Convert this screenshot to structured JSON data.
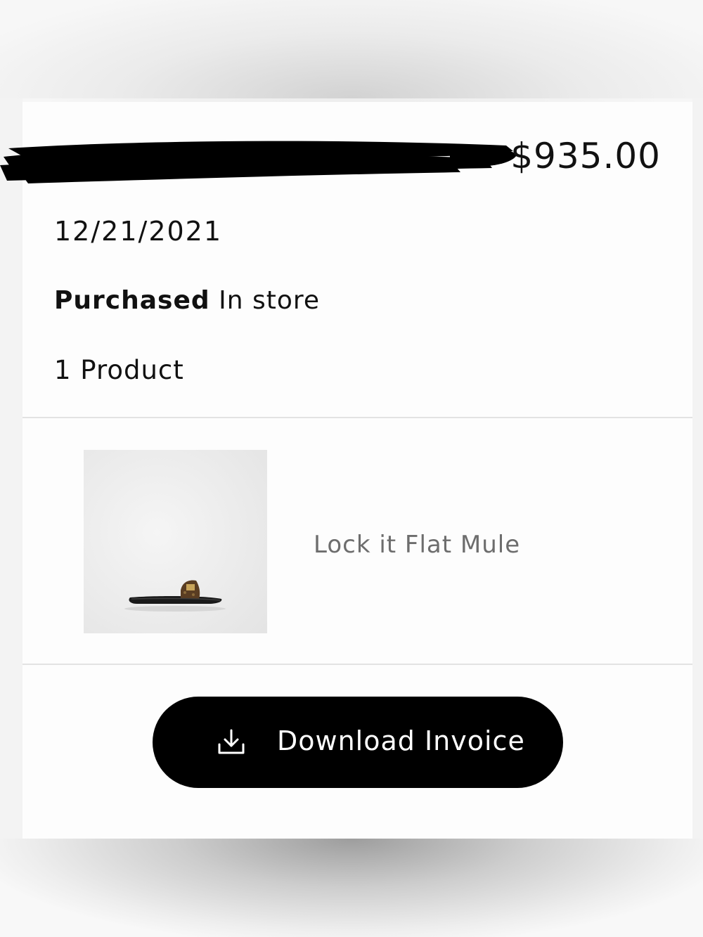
{
  "order": {
    "total": "$935.00",
    "date": "12/21/2021",
    "purchase_label": "Purchased",
    "purchase_channel": "In store",
    "product_count": "1 Product"
  },
  "product": {
    "name": "Lock it Flat Mule",
    "image_icon": "flat-mule-sandal-image"
  },
  "actions": {
    "download_label": "Download Invoice",
    "download_icon": "download-icon"
  },
  "colors": {
    "button_background": "#000000",
    "button_text": "#ffffff",
    "product_name_text": "#6d6d6d",
    "redaction": "#000000"
  }
}
